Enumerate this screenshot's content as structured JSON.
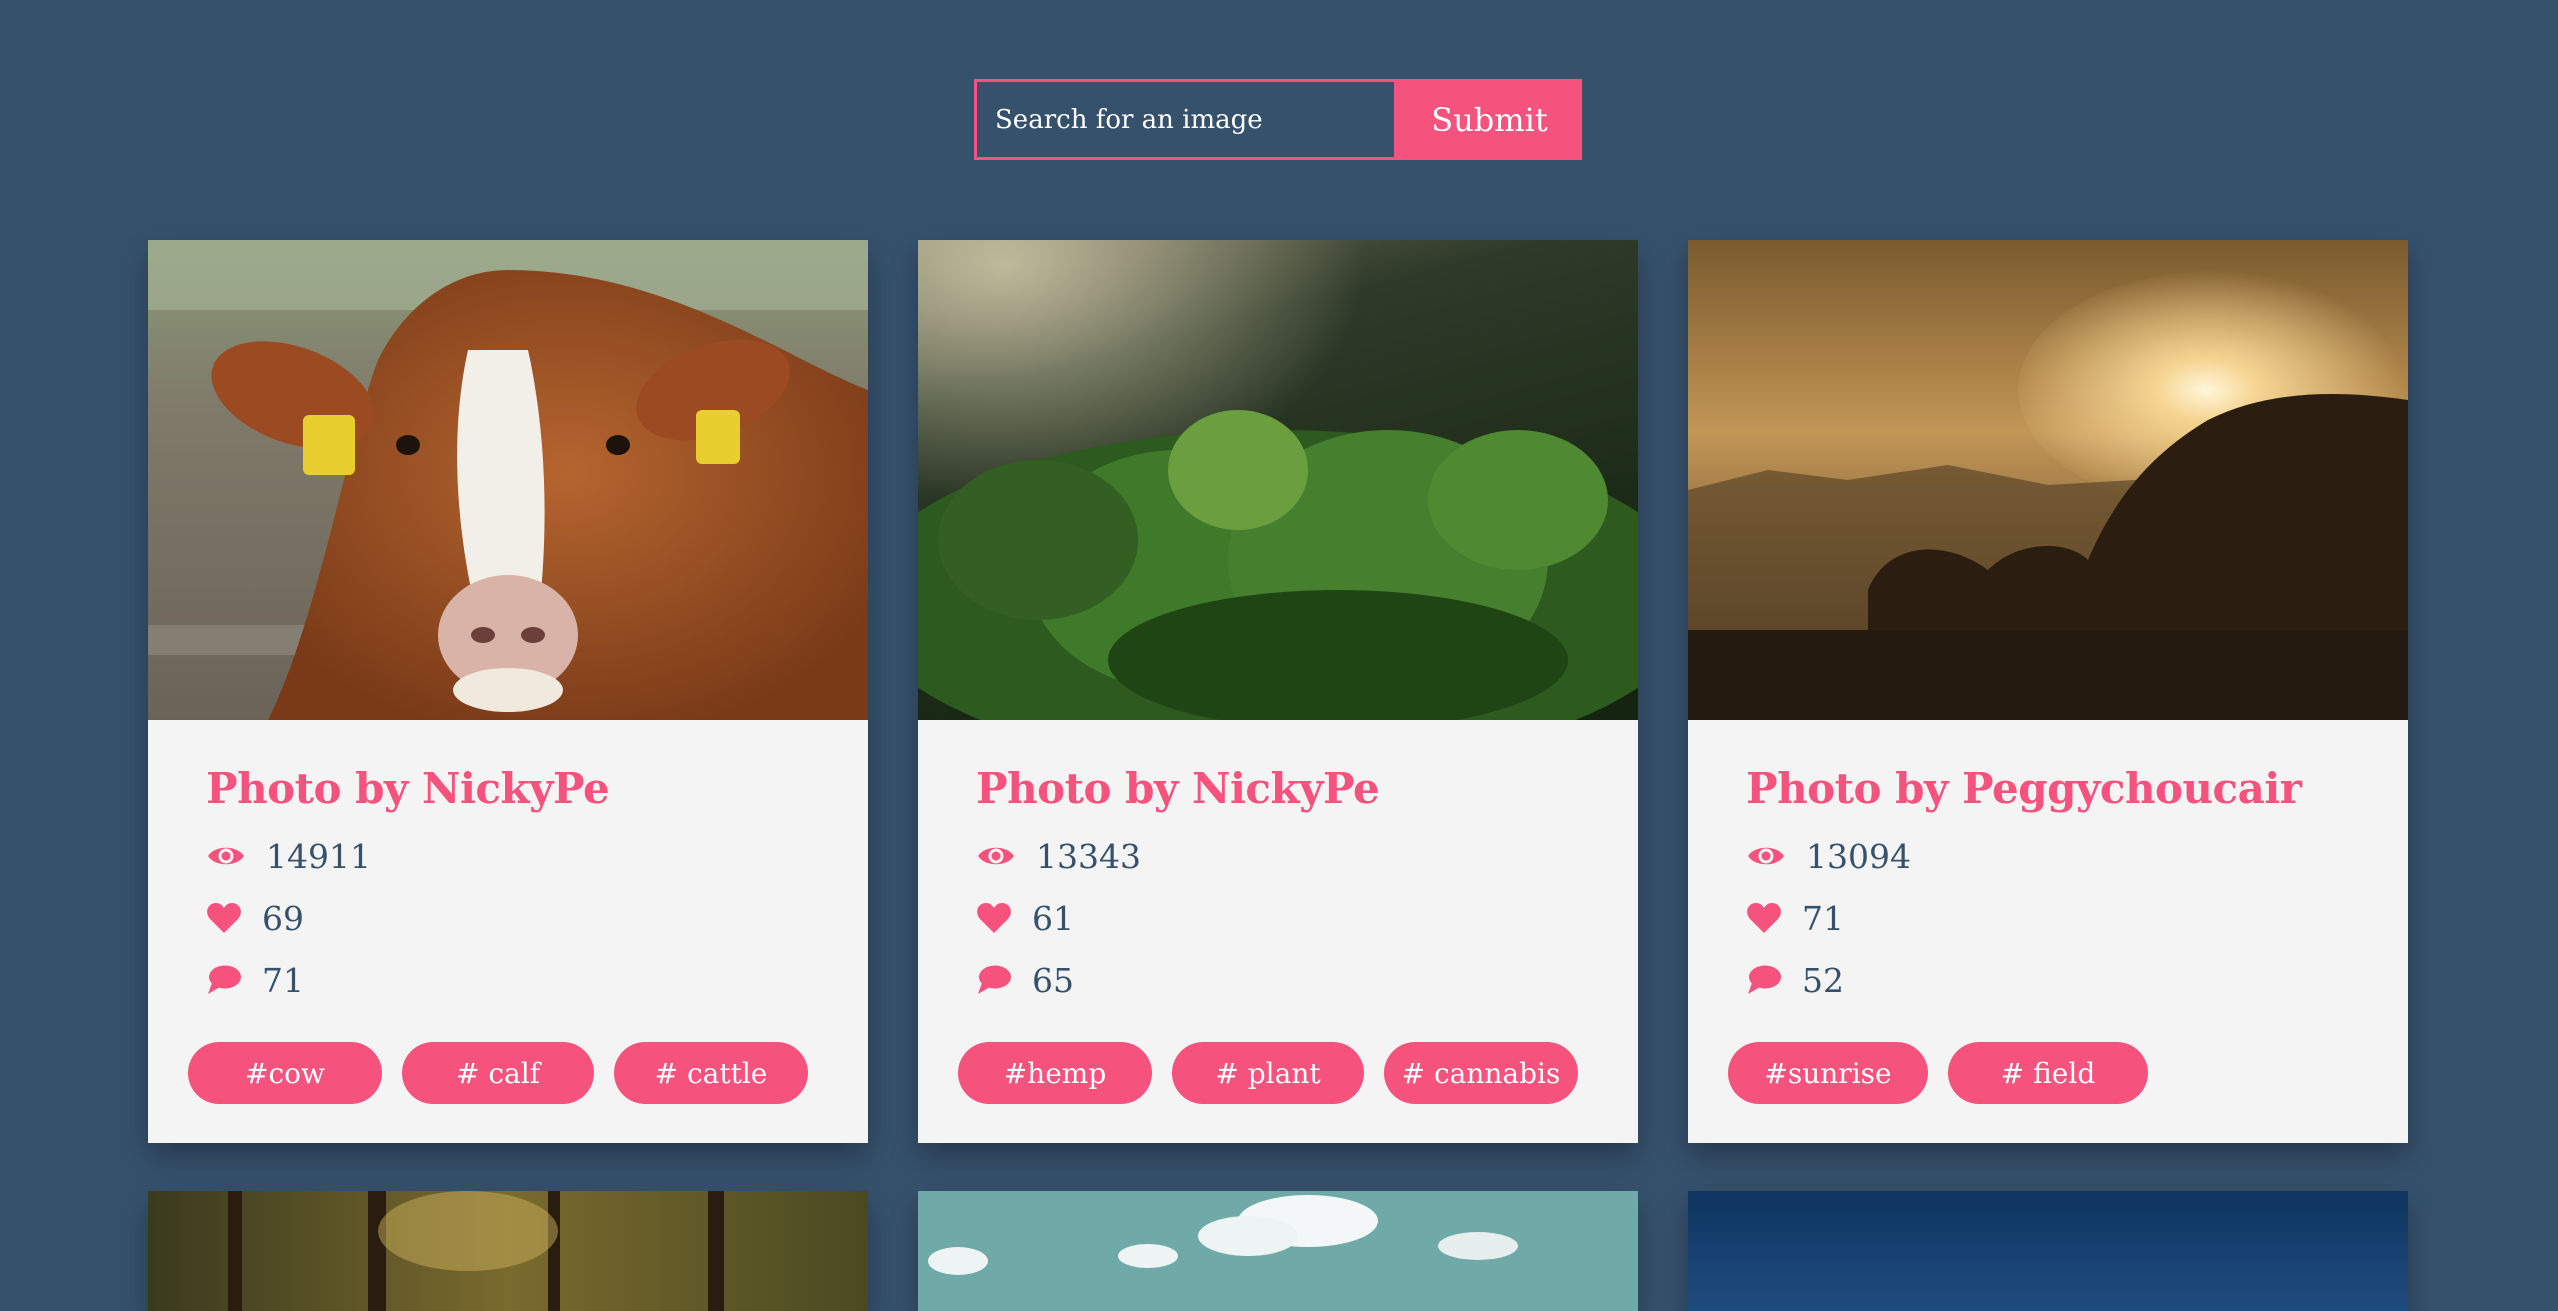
{
  "search": {
    "placeholder": "Search for an image",
    "submit_label": "Submit"
  },
  "cards": [
    {
      "title": "Photo by NickyPe",
      "views": "14911",
      "likes": "69",
      "comments": "71",
      "tags": [
        "#cow",
        "# calf",
        "# cattle"
      ]
    },
    {
      "title": "Photo by NickyPe",
      "views": "13343",
      "likes": "61",
      "comments": "65",
      "tags": [
        "#hemp",
        "# plant",
        "# cannabis"
      ]
    },
    {
      "title": "Photo by Peggychoucair",
      "views": "13094",
      "likes": "71",
      "comments": "52",
      "tags": [
        "#sunrise",
        "# field"
      ]
    }
  ],
  "icons": {
    "views": "eye-icon",
    "likes": "heart-icon",
    "comments": "comment-icon"
  },
  "colors": {
    "background": "#36516c",
    "accent": "#f5527e",
    "card": "#f4f4f4",
    "text": "#36516c"
  }
}
